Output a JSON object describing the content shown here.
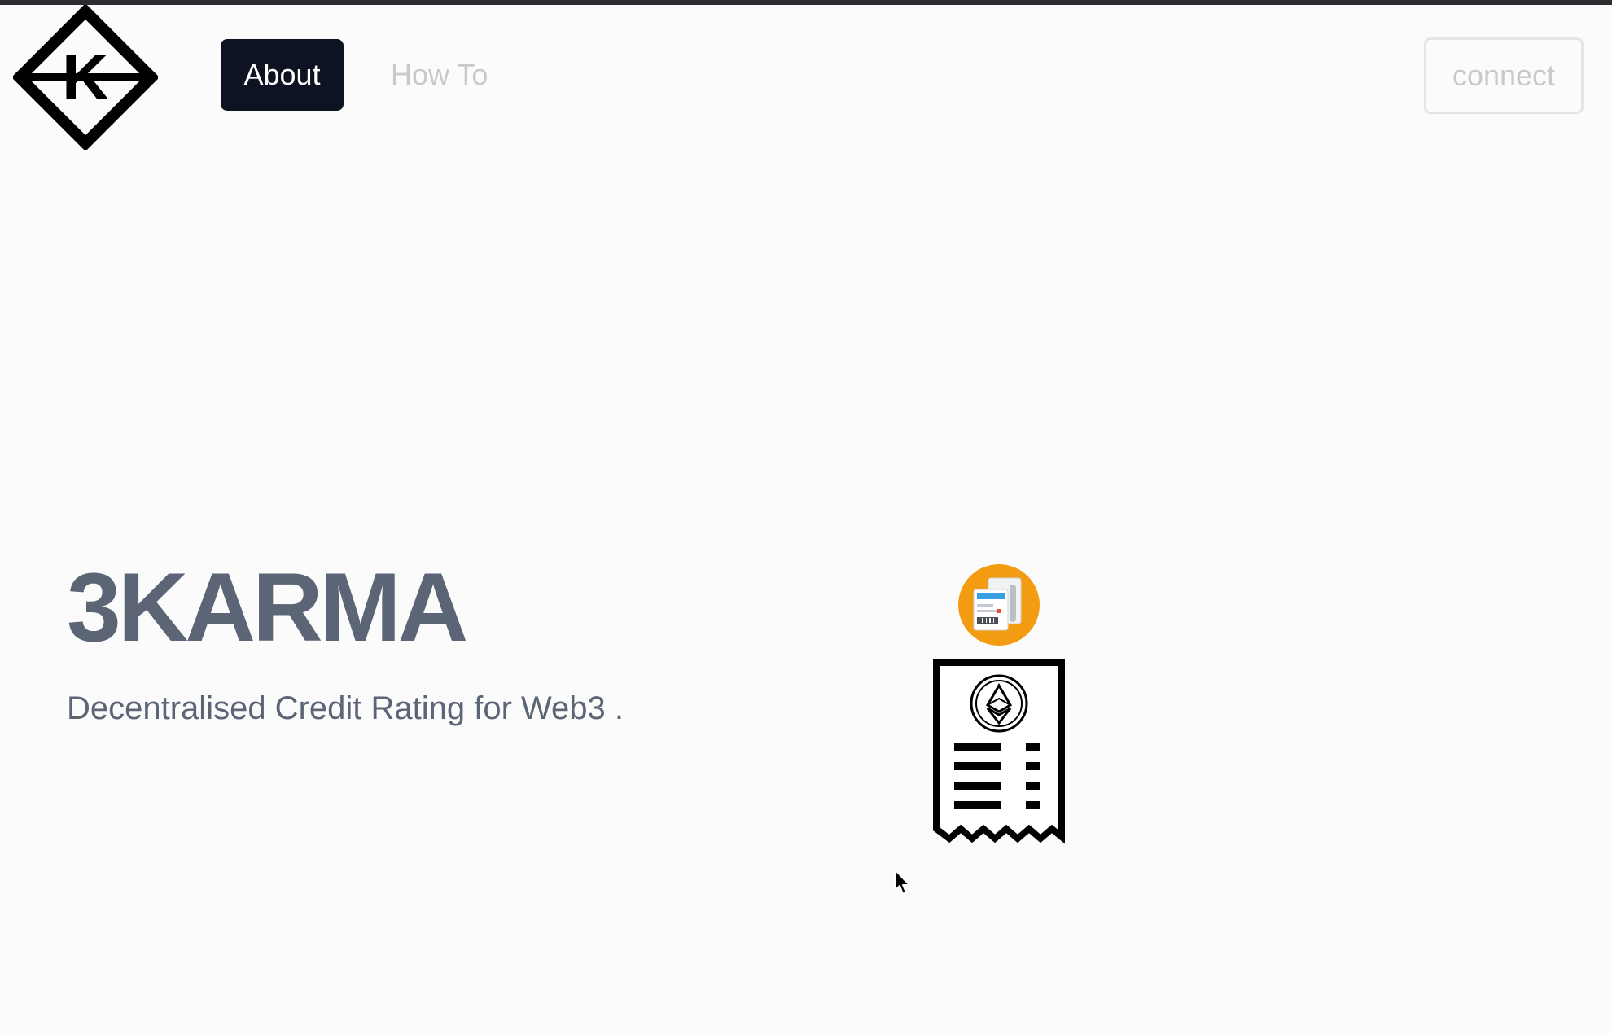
{
  "nav": {
    "about_label": "About",
    "howto_label": "How To",
    "connect_label": "connect"
  },
  "hero": {
    "title": "3KARMA",
    "subtitle": "Decentralised Credit Rating for Web3 ."
  },
  "logo": {
    "letter": "K"
  },
  "icons": {
    "logo": "diamond-k-logo",
    "badge": "documents-badge-icon",
    "receipt": "ethereum-receipt-icon",
    "cursor": "mouse-pointer-icon"
  },
  "colors": {
    "nav_active_bg": "#0e1321",
    "nav_inactive_text": "#c7c9cd",
    "hero_text": "#5b6575",
    "badge_orange": "#f39c12"
  }
}
